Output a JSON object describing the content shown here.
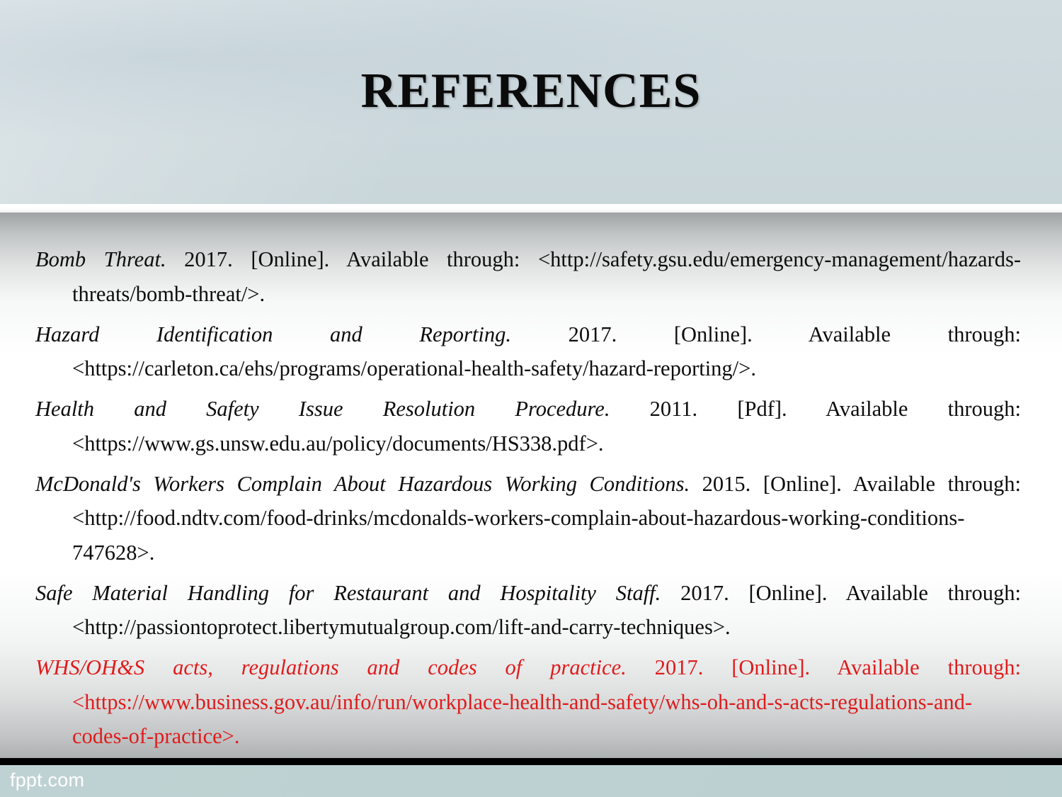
{
  "slide": {
    "title": "REFERENCES",
    "accent_red": "#e01b1b",
    "header_bg": "#ccd8dc",
    "footer_bg": "#bed1d2",
    "bottom_bar_color": "#000000",
    "text_color": "#0d0d0d"
  },
  "references": [
    {
      "title": "Bomb Threat.",
      "rest": " 2017. [Online]. Available through: <http://safety.gsu.edu/emergency-management/hazards-threats/bomb-threat/>.",
      "year": "2017",
      "format": "[Online]",
      "url": "http://safety.gsu.edu/emergency-management/hazards-threats/bomb-threat/",
      "color": "#0d0d0d"
    },
    {
      "title": "Hazard Identification and Reporting.",
      "rest": " 2017. [Online]. Available through: <https://carleton.ca/ehs/programs/operational-health-safety/hazard-reporting/>.",
      "year": "2017",
      "format": "[Online]",
      "url": "https://carleton.ca/ehs/programs/operational-health-safety/hazard-reporting/",
      "color": "#0d0d0d"
    },
    {
      "title": "Health and Safety Issue Resolution Procedure.",
      "rest": " 2011. [Pdf]. Available through: <https://www.gs.unsw.edu.au/policy/documents/HS338.pdf>.",
      "year": "2011",
      "format": "[Pdf]",
      "url": "https://www.gs.unsw.edu.au/policy/documents/HS338.pdf",
      "color": "#0d0d0d"
    },
    {
      "title": "McDonald's Workers Complain About Hazardous Working Conditions.",
      "rest": " 2015. [Online]. Available through: <http://food.ndtv.com/food-drinks/mcdonalds-workers-complain-about-hazardous-working-conditions-747628>.",
      "year": "2015",
      "format": "[Online]",
      "url": "http://food.ndtv.com/food-drinks/mcdonalds-workers-complain-about-hazardous-working-conditions-747628",
      "color": "#0d0d0d"
    },
    {
      "title": "Safe Material Handling for Restaurant and Hospitality Staff.",
      "rest": " 2017. [Online]. Available through: <http://passiontoprotect.libertymutualgroup.com/lift-and-carry-techniques>.",
      "year": "2017",
      "format": "[Online]",
      "url": "http://passiontoprotect.libertymutualgroup.com/lift-and-carry-techniques",
      "color": "#0d0d0d"
    },
    {
      "title": "WHS/OH&S acts, regulations and codes of practice.",
      "rest": " 2017. [Online]. Available through: <https://www.business.gov.au/info/run/workplace-health-and-safety/whs-oh-and-s-acts-regulations-and-codes-of-practice>.",
      "year": "2017",
      "format": "[Online]",
      "url": "https://www.business.gov.au/info/run/workplace-health-and-safety/whs-oh-and-s-acts-regulations-and-codes-of-practice",
      "color": "#e01b1b"
    }
  ],
  "footer": {
    "watermark": "fppt.com"
  }
}
